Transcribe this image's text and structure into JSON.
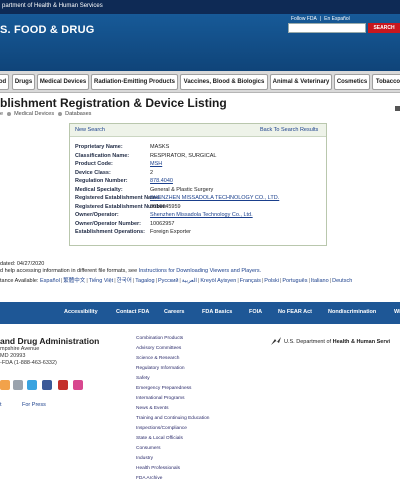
{
  "hhs_bar": {
    "text": "partment of Health & Human Services"
  },
  "header": {
    "brand": "S. FOOD & DRUG",
    "follow": "Follow FDA",
    "spanish": "En Español",
    "search_placeholder": "",
    "search_button": "SEARCH"
  },
  "nav": {
    "tabs": [
      "od",
      "Drugs",
      "Medical Devices",
      "Radiation-Emitting Products",
      "Vaccines, Blood & Biologics",
      "Animal & Veterinary",
      "Cosmetics",
      "Tobacco"
    ]
  },
  "page": {
    "title": "blishment Registration & Device Listing",
    "breadcrumb": [
      "e",
      "Medical Devices",
      "Databases"
    ]
  },
  "panel": {
    "new_search": "New Search",
    "back": "Back To Search Results",
    "rows": [
      {
        "label": "Proprietary Name:",
        "value": "MASKS"
      },
      {
        "label": "Classification Name:",
        "value": "RESPIRATOR, SURGICAL"
      },
      {
        "label": "Product Code:",
        "value": "MSH"
      },
      {
        "label": "Device Class:",
        "value": "2"
      },
      {
        "label": "Regulation Number:",
        "value": "878.4040"
      },
      {
        "label": "Medical Specialty:",
        "value": "General & Plastic Surgery"
      },
      {
        "label": "Registered Establishment Name:",
        "value": "SHENZHEN MISSADOLA TECHNOLOGY CO., LTD."
      },
      {
        "label": "Registered Establishment Number:",
        "value": "3016645959"
      },
      {
        "label": "Owner/Operator:",
        "value": "Shenzhen Missadola Technology Co., Ltd."
      },
      {
        "label": "Owner/Operator Number:",
        "value": "10062957"
      },
      {
        "label": "Establishment Operations:",
        "value": "Foreign Exporter"
      }
    ]
  },
  "info": {
    "updated": "dated: 04/27/2020",
    "help_prefix": "d help accessing information in different file formats, see ",
    "help_link": "Instructions for Downloading Viewers and Players.",
    "lang_prefix": "tance Available: ",
    "languages": [
      "Español",
      "繁體中文",
      "Tiếng Việt",
      "한국어",
      "Tagalog",
      "Русский",
      "العربية",
      "Kreyòl Ayisyen",
      "Français",
      "Polski",
      "Português",
      "Italiano",
      "Deutsch"
    ]
  },
  "footer_nav": [
    "Accessibility",
    "Contact FDA",
    "Careers",
    "FDA Basics",
    "FOIA",
    "No FEAR Act",
    "Nondiscrimination",
    "Wi"
  ],
  "footer": {
    "org": "and Drug Administration",
    "address": [
      "mpshire Avenue",
      "MD 20993",
      "-FDA (1-888-463-6332)"
    ],
    "links": [
      "t",
      "For Press"
    ],
    "columns": [
      "Combination Products",
      "Advisory Committees",
      "Science & Research",
      "Regulatory Information",
      "Safety",
      "Emergency Preparedness",
      "International Programs",
      "News & Events",
      "Training and Continuing Education",
      "Inspections/Compliance",
      "State & Local Officials",
      "Consumers",
      "Industry",
      "Health Professionals",
      "FDA Archive"
    ],
    "hhs_prefix": "U.S. Department of ",
    "hhs_bold": "Health & Human Servi"
  },
  "colors": {
    "header": "#175a98",
    "footer_nav": "#1e5796",
    "search_button": "#c8171e",
    "link": "#1a3f8c"
  }
}
